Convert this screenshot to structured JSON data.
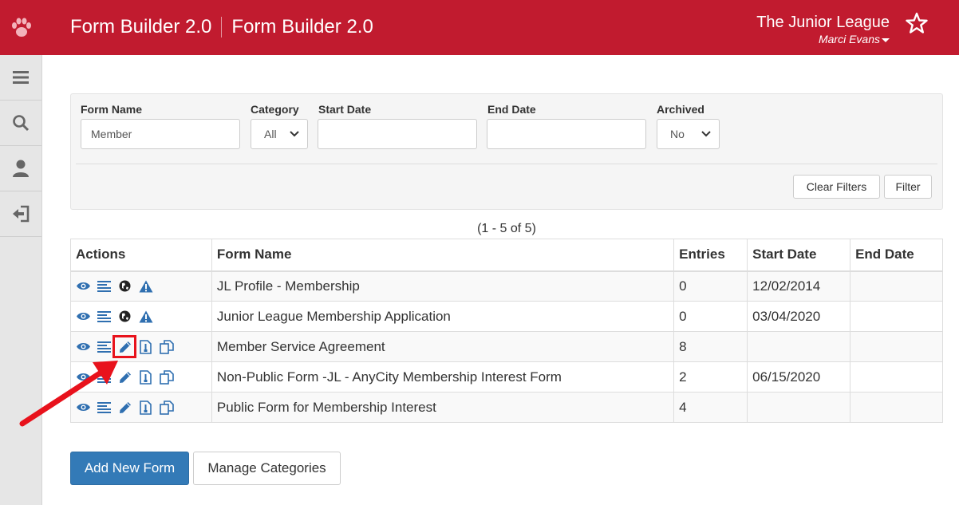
{
  "header": {
    "title": "Form Builder 2.0",
    "subtitle": "Form Builder 2.0",
    "org": "The Junior League",
    "user": "Marci Evans"
  },
  "colors": {
    "brand": "#c11b2f",
    "primary": "#337ab7",
    "link": "#2f6fb0",
    "annotation": "#e8121c"
  },
  "sidebar": {
    "items": [
      "menu-icon",
      "search-icon",
      "user-icon",
      "logout-icon"
    ]
  },
  "filters": {
    "form_name_label": "Form Name",
    "form_name_value": "Member",
    "category_label": "Category",
    "category_value": "All",
    "start_date_label": "Start Date",
    "start_date_value": "",
    "end_date_label": "End Date",
    "end_date_value": "",
    "archived_label": "Archived",
    "archived_value": "No",
    "clear_label": "Clear Filters",
    "filter_label": "Filter"
  },
  "count_text": "(1 - 5 of 5)",
  "table": {
    "headers": [
      "Actions",
      "Form Name",
      "Entries",
      "Start Date",
      "End Date"
    ],
    "rows": [
      {
        "name": "JL Profile - Membership",
        "entries": "0",
        "start": "12/02/2014",
        "end": ""
      },
      {
        "name": "Junior League Membership Application",
        "entries": "0",
        "start": "03/04/2020",
        "end": ""
      },
      {
        "name": "Member Service Agreement",
        "entries": "8",
        "start": "",
        "end": ""
      },
      {
        "name": "Non-Public Form -JL - AnyCity Membership Interest Form",
        "entries": "2",
        "start": "06/15/2020",
        "end": ""
      },
      {
        "name": "Public Form for Membership Interest",
        "entries": "4",
        "start": "",
        "end": ""
      }
    ]
  },
  "buttons": {
    "add_new": "Add New Form",
    "manage_categories": "Manage Categories"
  }
}
